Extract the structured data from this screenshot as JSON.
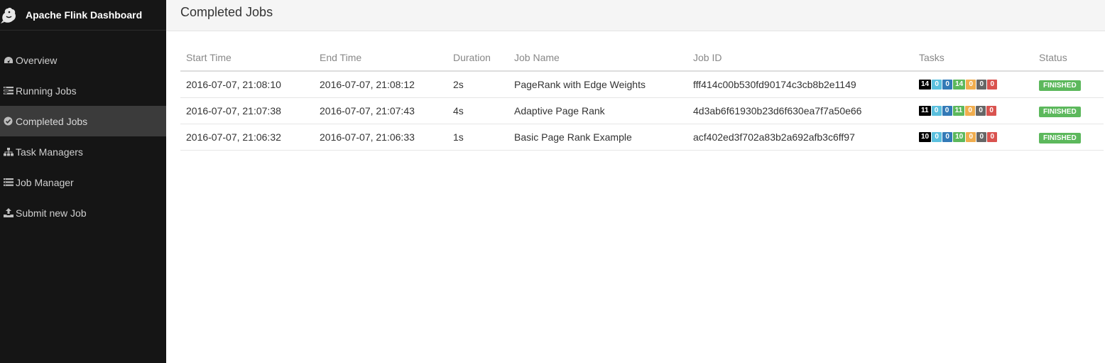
{
  "app": {
    "title": "Apache Flink Dashboard"
  },
  "sidebar": {
    "items": [
      {
        "label": "Overview",
        "icon": "dashboard-icon"
      },
      {
        "label": "Running Jobs",
        "icon": "tasks-icon"
      },
      {
        "label": "Completed Jobs",
        "icon": "check-circle-icon"
      },
      {
        "label": "Task Managers",
        "icon": "sitemap-icon"
      },
      {
        "label": "Job Manager",
        "icon": "list-icon"
      },
      {
        "label": "Submit new Job",
        "icon": "upload-icon"
      }
    ]
  },
  "page": {
    "title": "Completed Jobs"
  },
  "table": {
    "headers": [
      "Start Time",
      "End Time",
      "Duration",
      "Job Name",
      "Job ID",
      "Tasks",
      "Status"
    ],
    "rows": [
      {
        "start": "2016-07-07, 21:08:10",
        "end": "2016-07-07, 21:08:12",
        "duration": "2s",
        "name": "PageRank with Edge Weights",
        "id": "fff414c00b530fd90174c3cb8b2e1149",
        "tasks": [
          "14",
          "0",
          "0",
          "14",
          "0",
          "0",
          "0"
        ],
        "status": "FINISHED"
      },
      {
        "start": "2016-07-07, 21:07:38",
        "end": "2016-07-07, 21:07:43",
        "duration": "4s",
        "name": "Adaptive Page Rank",
        "id": "4d3ab6f61930b23d6f630ea7f7a50e66",
        "tasks": [
          "11",
          "0",
          "0",
          "11",
          "0",
          "0",
          "0"
        ],
        "status": "FINISHED"
      },
      {
        "start": "2016-07-07, 21:06:32",
        "end": "2016-07-07, 21:06:33",
        "duration": "1s",
        "name": "Basic Page Rank Example",
        "id": "acf402ed3f702a83b2a692afb3c6ff97",
        "tasks": [
          "10",
          "0",
          "0",
          "10",
          "0",
          "0",
          "0"
        ],
        "status": "FINISHED"
      }
    ]
  },
  "colors": {
    "task_badges": [
      "#000000",
      "#5bc0de",
      "#337ab7",
      "#5cb85c",
      "#f0ad4e",
      "#666666",
      "#d9534f"
    ],
    "finished": "#5cb85c",
    "sidebar_bg": "#151515",
    "sidebar_active": "#3b3b3b"
  }
}
